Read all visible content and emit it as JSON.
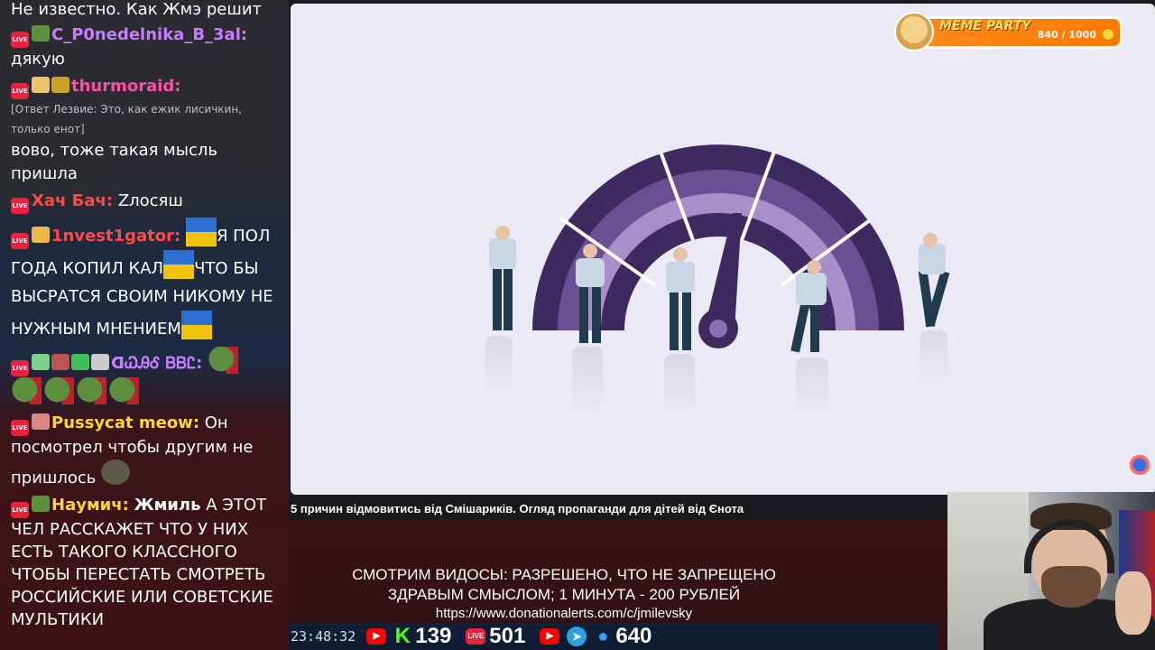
{
  "chat": {
    "messages": [
      {
        "text": "Не известно. Как Жмэ решит"
      },
      {
        "name": "C_P0nedelnika_B_3al:",
        "name_color": "#c77dff",
        "text": "дякую"
      },
      {
        "name": "thurmoraid:",
        "name_color": "#ff4fa3",
        "reply": "[Ответ Лезвие: Это, как ежик лисичкин, только енот]",
        "text": "вово, тоже такая мысль пришла"
      },
      {
        "name": "Хач Бач:",
        "name_color": "#ff4a4a",
        "text": "Zлосяш"
      },
      {
        "name": "1nvest1gator:",
        "name_color": "#ff4a4a",
        "text_a": "Я ПОЛ ГОДА КОПИЛ КАЛ",
        "text_b": "ЧТО БЫ ВЫСРАТСЯ СВОИМ НИКОМУ НЕ НУЖНЫМ МНЕНИЕМ"
      },
      {
        "name": "ꓷᏇᎯᎴ ᏴᏴᏝ:",
        "name_color": "#c77dff"
      },
      {
        "name": "Pussycat meow:",
        "name_color": "#ffd23a",
        "text": "Он посмотрел чтобы другим не пришлось"
      },
      {
        "name": "Наумич:",
        "name_color": "#ffd23a",
        "mention": "Жмиль",
        "text": "А ЭТОТ ЧЕЛ РАССКАЖЕТ ЧТО У НИХ ЕСТЬ ТАКОГО КЛАССНОГО ЧТОБЫ ПЕРЕСТАТЬ СМОТРЕТЬ РОССИЙСКИЕ ИЛИ СОВЕТСКИЕ МУЛЬТИКИ"
      }
    ],
    "live_label": "LIVE"
  },
  "meme_party": {
    "title": "MEME PARTY",
    "value": "840 / 1000",
    "progress": 0.84
  },
  "video": {
    "title": "5 причин відмовитись від Смішариків. Огляд пропаганди для дітей від Єнота",
    "accent_dark": "#3f2a60",
    "accent_mid": "#6b4f95",
    "accent_light": "#a98fc9"
  },
  "caption": {
    "line1": "СМОТРИМ ВИДОСЫ: РАЗРЕШЕНО, ЧТО НЕ ЗАПРЕЩЕНО",
    "line2": "ЗДРАВЫМ СМЫСЛОМ; 1 МИНУТА - 200 РУБЛЕЙ",
    "link": "https://www.donationalerts.com/c/jmilevsky"
  },
  "stats": {
    "clock": "23:48:32",
    "kick": "139",
    "vk": "501",
    "viewers": "640",
    "icons": [
      "youtube-icon",
      "kick-icon",
      "vk-live-icon",
      "youtube-icon",
      "telegram-icon",
      "user-icon"
    ]
  }
}
